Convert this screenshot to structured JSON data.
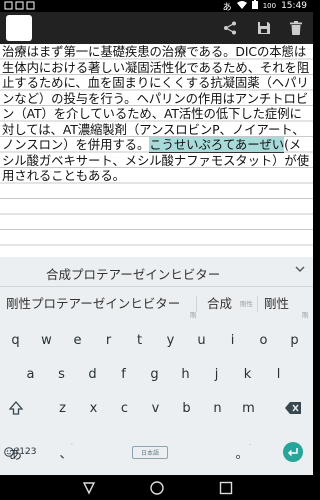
{
  "status": {
    "carrier": "あ",
    "battery": "100",
    "time": "15:49"
  },
  "editor": {
    "text_before": "治療はまず第一に基礎疾患の治療である。DICの本態は生体内における著しい凝固活性化であるため、それを阻止するために、血を固まりにくくする抗凝固薬（ヘパリンなど）の投与を行う。ヘパリンの作用はアンチトロビン（AT）を介しているため、AT活性の低下した症例に対しては、AT濃縮製剤（アンスロビンP、ノイアート、ノンスロン）を併用する。",
    "composing": "こうせいぷろてあーぜい",
    "text_after": "(メシル酸ガベキサート、メシル酸ナファモスタット）が使用されることもある。"
  },
  "suggestions": {
    "top": "合成プロテアーゼインヒビター",
    "candidates": [
      {
        "text": "剛性プロテアーゼインヒビター",
        "ann": "剛"
      },
      {
        "text": "合成",
        "ann": "剛性"
      },
      {
        "text": "剛性",
        "ann": "剛"
      }
    ]
  },
  "keyboard": {
    "row1": [
      "q",
      "w",
      "e",
      "r",
      "t",
      "y",
      "u",
      "i",
      "o",
      "p"
    ],
    "row2": [
      "a",
      "s",
      "d",
      "f",
      "g",
      "h",
      "j",
      "k",
      "l"
    ],
    "row3": [
      "z",
      "x",
      "c",
      "v",
      "b",
      "n",
      "m"
    ],
    "symbols_label": "?123",
    "space_label": "日本語",
    "lang_key": "あ",
    "comma": "、",
    "period": "。",
    "comma_hint": ",",
    "period_hint": "."
  },
  "colors": {
    "accent": "#26a69a",
    "highlight": "#a8dada"
  }
}
